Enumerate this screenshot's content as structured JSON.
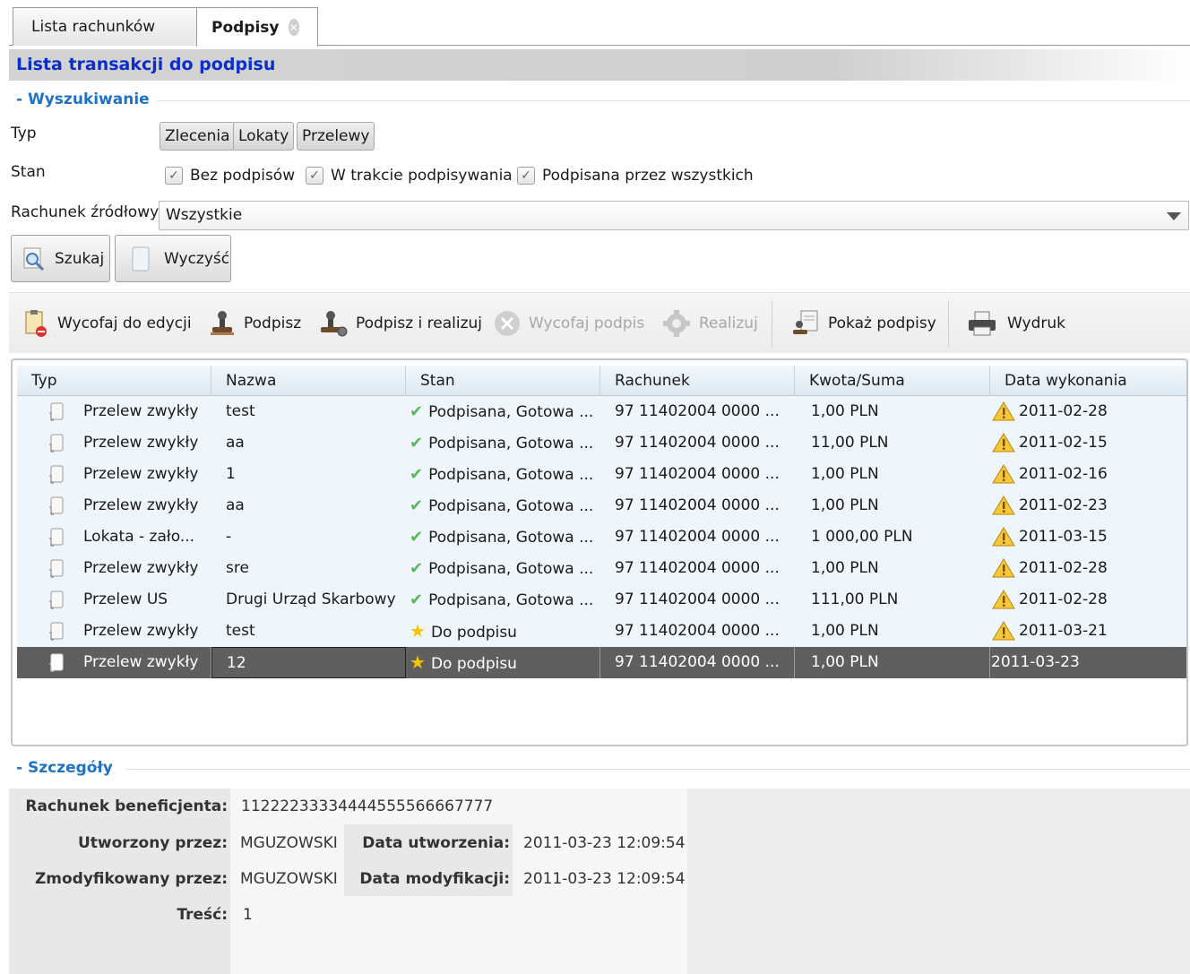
{
  "tabs": [
    {
      "label": "Lista rachunków"
    },
    {
      "label": "Podpisy"
    }
  ],
  "title": "Lista transakcji do podpisu",
  "search": {
    "header": "- Wyszukiwanie",
    "typ_label": "Typ",
    "typ_options": [
      "Zlecenia",
      "Lokaty",
      "Przelewy"
    ],
    "stan_label": "Stan",
    "stan_options": [
      {
        "label": "Bez podpisów",
        "checked": true
      },
      {
        "label": "W trakcie podpisywania",
        "checked": true
      },
      {
        "label": "Podpisana przez wszystkich",
        "checked": true
      }
    ],
    "rachunek_label": "Rachunek źródłowy",
    "rachunek_value": "Wszystkie",
    "search_button": "Szukaj",
    "clear_button": "Wyczyść"
  },
  "toolbar": {
    "withdraw_edit": "Wycofaj do edycji",
    "sign": "Podpisz",
    "sign_execute": "Podpisz i realizuj",
    "withdraw_sign": "Wycofaj podpis",
    "execute": "Realizuj",
    "show_signatures": "Pokaż podpisy",
    "print": "Wydruk"
  },
  "grid": {
    "columns": [
      "Typ",
      "Nazwa",
      "Stan",
      "Rachunek",
      "Kwota/Suma",
      "Data wykonania"
    ],
    "rows": [
      {
        "typ": "Przelew zwykły",
        "nazwa": "test",
        "stan": "Podpisana, Gotowa ...",
        "status_icon": "check",
        "rachunek": "97 11402004 0000 ...",
        "kwota": "1,00 PLN",
        "data": "2011-02-28",
        "warn": true
      },
      {
        "typ": "Przelew zwykły",
        "nazwa": "aa",
        "stan": "Podpisana, Gotowa ...",
        "status_icon": "check",
        "rachunek": "97 11402004 0000 ...",
        "kwota": "11,00 PLN",
        "data": "2011-02-15",
        "warn": true
      },
      {
        "typ": "Przelew zwykły",
        "nazwa": "1",
        "stan": "Podpisana, Gotowa ...",
        "status_icon": "check",
        "rachunek": "97 11402004 0000 ...",
        "kwota": "1,00 PLN",
        "data": "2011-02-16",
        "warn": true
      },
      {
        "typ": "Przelew zwykły",
        "nazwa": "aa",
        "stan": "Podpisana, Gotowa ...",
        "status_icon": "check",
        "rachunek": "97 11402004 0000 ...",
        "kwota": "1,00 PLN",
        "data": "2011-02-23",
        "warn": true
      },
      {
        "typ": "Lokata - zało...",
        "nazwa": "-",
        "stan": "Podpisana, Gotowa ...",
        "status_icon": "check",
        "rachunek": "97 11402004 0000 ...",
        "kwota": "1 000,00 PLN",
        "data": "2011-03-15",
        "warn": true
      },
      {
        "typ": "Przelew zwykły",
        "nazwa": "sre",
        "stan": "Podpisana, Gotowa ...",
        "status_icon": "check",
        "rachunek": "97 11402004 0000 ...",
        "kwota": "1,00 PLN",
        "data": "2011-02-28",
        "warn": true
      },
      {
        "typ": "Przelew US",
        "nazwa": "Drugi Urząd Skarbowy",
        "stan": "Podpisana, Gotowa ...",
        "status_icon": "check",
        "rachunek": "97 11402004 0000 ...",
        "kwota": "111,00 PLN",
        "data": "2011-02-28",
        "warn": true
      },
      {
        "typ": "Przelew zwykły",
        "nazwa": "test",
        "stan": "Do podpisu",
        "status_icon": "star",
        "rachunek": "97 11402004 0000 ...",
        "kwota": "1,00 PLN",
        "data": "2011-03-21",
        "warn": true
      },
      {
        "typ": "Przelew zwykły",
        "nazwa": "12",
        "stan": "Do podpisu",
        "status_icon": "star",
        "rachunek": "97 11402004 0000 ...",
        "kwota": "1,00 PLN",
        "data": "2011-03-23",
        "warn": false,
        "selected": true
      }
    ]
  },
  "details": {
    "header": "- Szczegóły",
    "beneficiary_label": "Rachunek beneficjenta:",
    "beneficiary_value": "11222233334444555566667777",
    "created_by_label": "Utworzony przez:",
    "created_by_value": "MGUZOWSKI",
    "created_date_label": "Data utworzenia:",
    "created_date_value": "2011-03-23 12:09:54",
    "modified_by_label": "Zmodyfikowany przez:",
    "modified_by_value": "MGUZOWSKI",
    "modified_date_label": "Data modyfikacji:",
    "modified_date_value": "2011-03-23 12:09:54",
    "content_label": "Treść:",
    "content_value": "1"
  }
}
